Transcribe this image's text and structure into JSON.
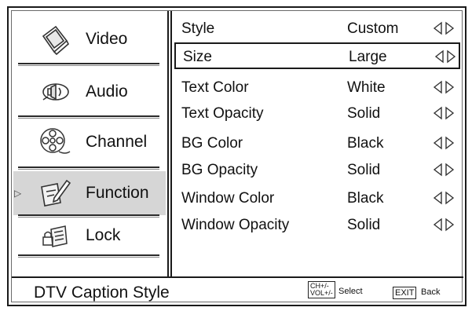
{
  "sidebar": {
    "items": [
      {
        "label": "Video",
        "icon": "video-icon",
        "selected": false
      },
      {
        "label": "Audio",
        "icon": "audio-icon",
        "selected": false
      },
      {
        "label": "Channel",
        "icon": "channel-icon",
        "selected": false
      },
      {
        "label": "Function",
        "icon": "function-icon",
        "selected": true
      },
      {
        "label": "Lock",
        "icon": "lock-icon",
        "selected": false
      }
    ]
  },
  "options": [
    {
      "name": "Style",
      "value": "Custom"
    },
    {
      "name": "Size",
      "value": "Large",
      "selected": true
    },
    {
      "name": "Text Color",
      "value": "White"
    },
    {
      "name": "Text Opacity",
      "value": "Solid"
    },
    {
      "name": "BG Color",
      "value": "Black"
    },
    {
      "name": "BG Opacity",
      "value": "Solid"
    },
    {
      "name": "Window Color",
      "value": "Black"
    },
    {
      "name": "Window Opacity",
      "value": "Solid"
    }
  ],
  "status": {
    "title": "DTV Caption Style",
    "key_ch": "CH+/-",
    "key_vol": "VOL+/-",
    "select_label": "Select",
    "exit_key": "EXIT",
    "back_label": "Back"
  }
}
